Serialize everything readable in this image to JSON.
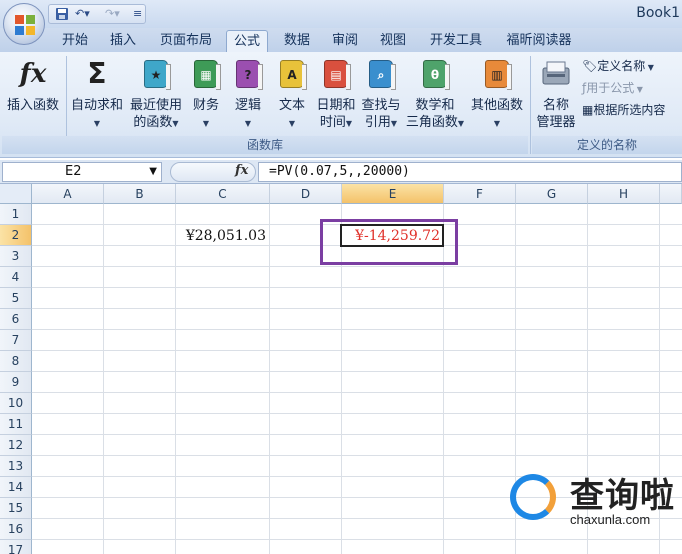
{
  "window": {
    "title": "Book1"
  },
  "tabs": [
    "开始",
    "插入",
    "页面布局",
    "公式",
    "数据",
    "审阅",
    "视图",
    "开发工具",
    "福昕阅读器"
  ],
  "active_tab": "公式",
  "ribbon": {
    "function_library": {
      "label": "函数库",
      "buttons": [
        {
          "label": "插入函数",
          "icon": "fx-icon"
        },
        {
          "label": "自动求和",
          "icon": "sigma-icon"
        },
        {
          "label1": "最近使用",
          "label2": "的函数",
          "icon": "book-star-icon",
          "color": "#3fa7c9"
        },
        {
          "label": "财务",
          "icon": "book-money-icon",
          "color": "#3e9b57"
        },
        {
          "label": "逻辑",
          "icon": "book-question-icon",
          "color": "#9b4fb0"
        },
        {
          "label": "文本",
          "icon": "book-a-icon",
          "color": "#e8c23a",
          "glyph": "A"
        },
        {
          "label1": "日期和",
          "label2": "时间",
          "icon": "book-calendar-icon",
          "color": "#d9503e"
        },
        {
          "label1": "查找与",
          "label2": "引用",
          "icon": "book-search-icon",
          "color": "#3a8fce"
        },
        {
          "label1": "数学和",
          "label2": "三角函数",
          "icon": "book-theta-icon",
          "color": "#4fa36b",
          "glyph": "θ"
        },
        {
          "label": "其他函数",
          "icon": "book-more-icon",
          "color": "#e88a3a"
        }
      ]
    },
    "defined_names": {
      "label": "定义的名称",
      "name_manager": {
        "label1": "名称",
        "label2": "管理器"
      },
      "define_name": "定义名称",
      "use_in_formula": "用于公式",
      "create_from_selection": "根据所选内容"
    }
  },
  "formula_bar": {
    "name_box": "E2",
    "fx": "fx",
    "formula": "=PV(0.07,5,,20000)"
  },
  "sheet": {
    "columns": [
      "A",
      "B",
      "C",
      "D",
      "E",
      "F",
      "G",
      "H"
    ],
    "rows": [
      "1",
      "2",
      "3",
      "4",
      "5",
      "6",
      "7",
      "8",
      "9",
      "10",
      "11",
      "12",
      "13",
      "14",
      "15",
      "16",
      "17"
    ],
    "cells": {
      "C2": "¥28,051.03",
      "E2": "¥-14,259.72"
    },
    "active_cell": "E2",
    "colors": {
      "negative": "#e0312a",
      "highlight_border": "#7b3ea2"
    }
  },
  "watermark": {
    "text": "查询啦",
    "url": "chaxunla.com"
  }
}
